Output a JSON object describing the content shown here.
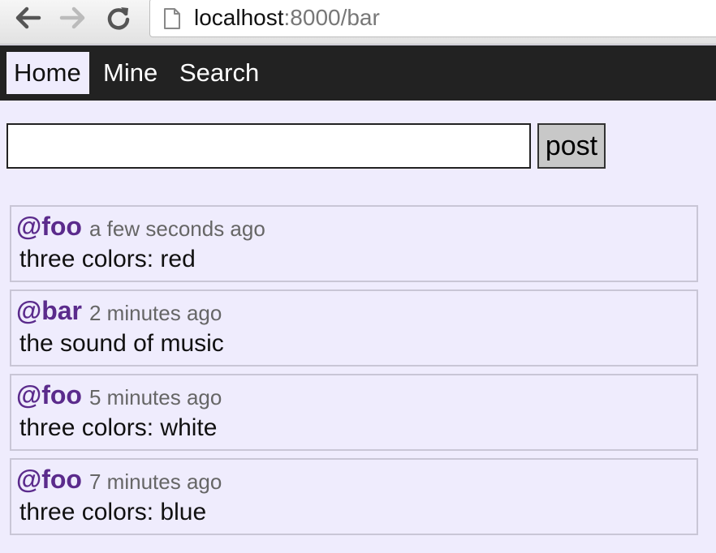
{
  "browser": {
    "url_host": "localhost",
    "url_rest": ":8000/bar"
  },
  "nav": {
    "items": [
      {
        "label": "Home",
        "active": true
      },
      {
        "label": "Mine",
        "active": false
      },
      {
        "label": "Search",
        "active": false
      }
    ]
  },
  "composer": {
    "input_value": "",
    "button_label": "post"
  },
  "feed": {
    "posts": [
      {
        "author": "@foo",
        "time": "a few seconds ago",
        "body": "three colors: red"
      },
      {
        "author": "@bar",
        "time": "2 minutes ago",
        "body": "the sound of music"
      },
      {
        "author": "@foo",
        "time": "5 minutes ago",
        "body": "three colors: white"
      },
      {
        "author": "@foo",
        "time": "7 minutes ago",
        "body": "three colors: blue"
      }
    ]
  },
  "colors": {
    "page_background": "#efecfd",
    "nav_background": "#222222",
    "author_link": "#5b2b8c"
  }
}
